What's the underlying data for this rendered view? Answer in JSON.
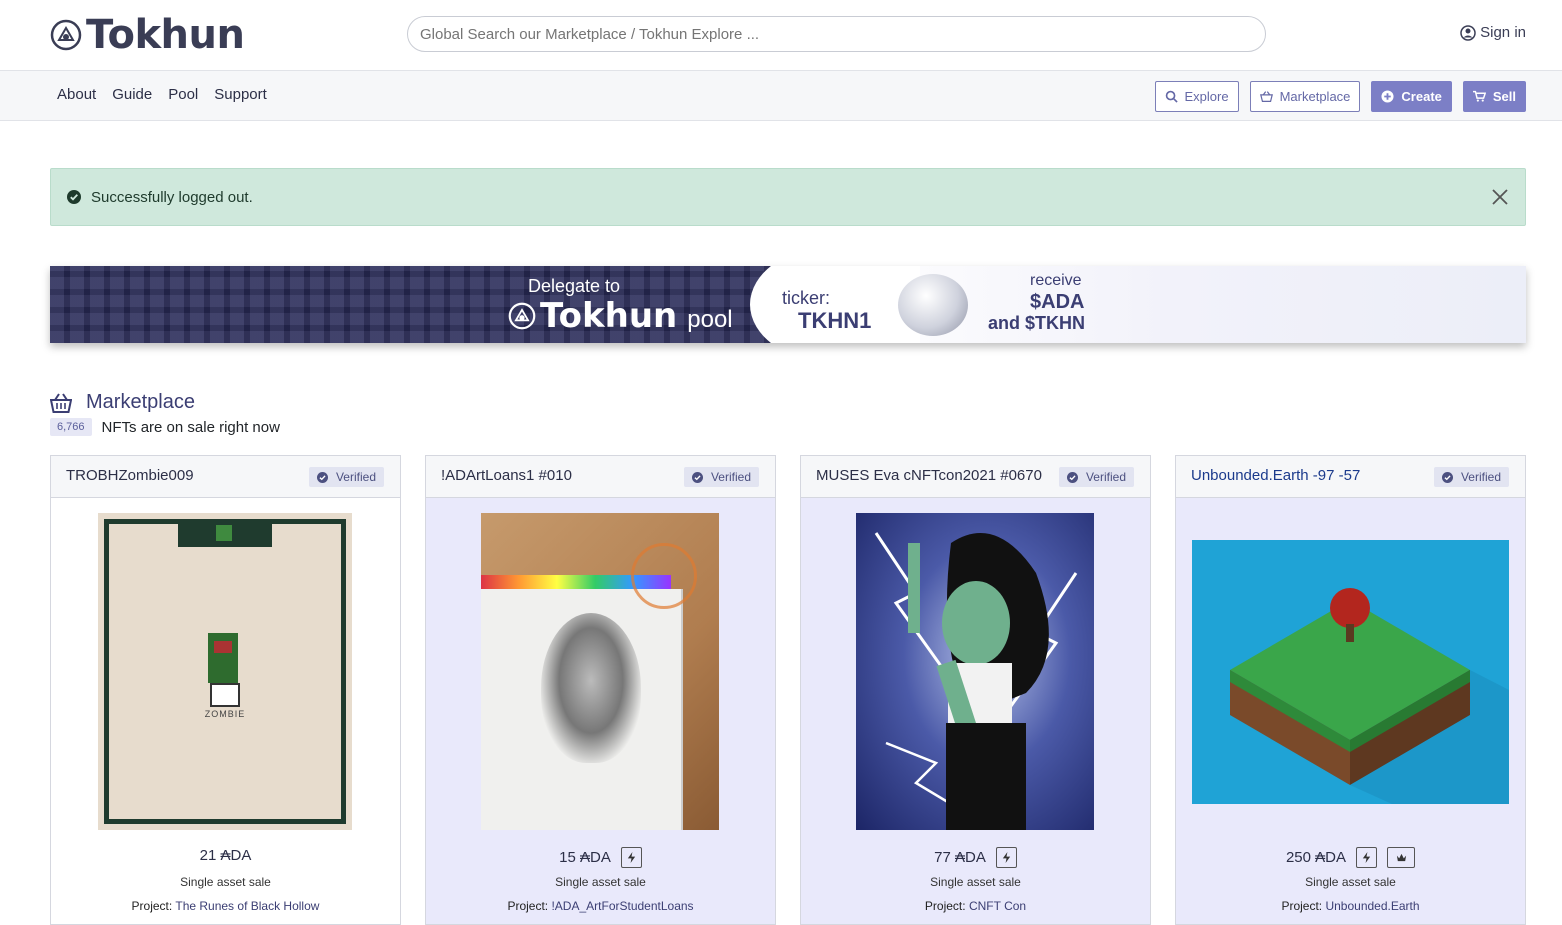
{
  "header": {
    "brand": "Tokhun",
    "search_placeholder": "Global Search our Marketplace / Tokhun Explore ...",
    "signin_label": "Sign in"
  },
  "nav": {
    "links": [
      "About",
      "Guide",
      "Pool",
      "Support"
    ],
    "actions": {
      "explore": "Explore",
      "marketplace": "Marketplace",
      "create": "Create",
      "sell": "Sell"
    }
  },
  "alert": {
    "message": "Successfully logged out."
  },
  "banner": {
    "delegate": "Delegate to",
    "brand": "Tokhun",
    "pool": "pool",
    "ticker_label": "ticker:",
    "ticker": "TKHN1",
    "receive": "receive",
    "reward_ada": "$ADA",
    "reward_tkhn": "and $TKHN"
  },
  "marketplace": {
    "title": "Marketplace",
    "count": "6,766",
    "count_text": "NFTs are on sale right now"
  },
  "cards": [
    {
      "name": "TROBHZombie009",
      "verified": "Verified",
      "price": "21 ₳DA",
      "sale_type": "Single asset sale",
      "project_label": "Project:",
      "project": "The Runes of Black Hollow",
      "art_text": "ZOMBIE"
    },
    {
      "name": "!ADArtLoans1 #010",
      "verified": "Verified",
      "price": "15 ₳DA",
      "sale_type": "Single asset sale",
      "project_label": "Project:",
      "project": "!ADA_ArtForStudentLoans"
    },
    {
      "name": "MUSES Eva cNFTcon2021 #0670",
      "verified": "Verified",
      "price": "77 ₳DA",
      "sale_type": "Single asset sale",
      "project_label": "Project:",
      "project": "CNFT Con"
    },
    {
      "name": "Unbounded.Earth -97 -57",
      "verified": "Verified",
      "price": "250 ₳DA",
      "sale_type": "Single asset sale",
      "project_label": "Project:",
      "project": "Unbounded.Earth"
    }
  ],
  "colors": {
    "accent": "#7c7fc6",
    "alert_bg": "#cfe8dc",
    "card_alt": "#e9e9fb",
    "text_dark": "#3b3e73"
  }
}
